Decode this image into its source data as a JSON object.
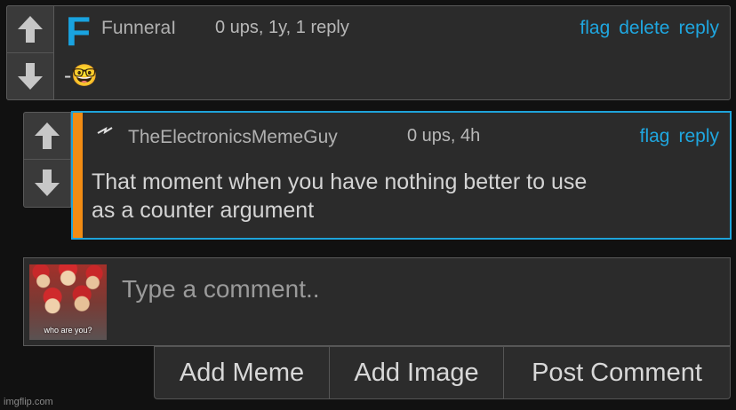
{
  "comments": [
    {
      "author": "FunneraI",
      "author_icon": "F",
      "meta": "0 ups, 1y, 1 reply",
      "actions": {
        "flag": "flag",
        "delete": "delete",
        "reply": "reply"
      },
      "body_prefix": "-",
      "body_emoji": "🤓"
    },
    {
      "author": "TheElectronicsMemeGuy",
      "meta": "0 ups, 4h",
      "actions": {
        "flag": "flag",
        "reply": "reply"
      },
      "body_line1": "That moment when you have nothing better to use",
      "body_line2": "as a counter argument",
      "accent_color": "#f28c13",
      "highlight_border": "#1ea3da"
    }
  ],
  "composer": {
    "placeholder": "Type a comment..",
    "avatar_caption": "who are you?"
  },
  "buttons": {
    "add_meme": "Add Meme",
    "add_image": "Add Image",
    "post_comment": "Post Comment"
  },
  "watermark": "imgflip.com",
  "colors": {
    "link": "#1fa7e0",
    "background": "#111111",
    "panel": "#2b2b2b"
  }
}
